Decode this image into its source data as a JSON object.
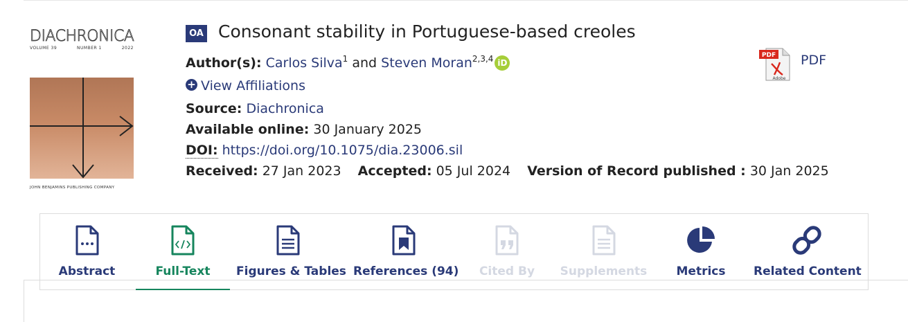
{
  "cover": {
    "journal": "DIACHRONICA",
    "volume": "VOLUME 39",
    "number": "NUMBER 1",
    "year": "2022",
    "publisher": "JOHN BENJAMINS PUBLISHING COMPANY"
  },
  "article": {
    "badge": "OA",
    "title": "Consonant stability in Portuguese-based creoles",
    "authors_label": "Author(s):",
    "author1": "Carlos Silva",
    "author1_sup": "1",
    "and": "and",
    "author2": "Steven Moran",
    "author2_sup": "2,3,4",
    "orcid": "iD",
    "view_affiliations": "View Affiliations",
    "source_label": "Source:",
    "source": "Diachronica",
    "available_label": "Available online:",
    "available": "30 January 2025",
    "doi_label": "DOI:",
    "doi": "https://doi.org/10.1075/dia.23006.sil",
    "received_label": "Received:",
    "received": "27 Jan 2023",
    "accepted_label": "Accepted:",
    "accepted": "05 Jul 2024",
    "vor_label": "Version of Record published :",
    "vor": "30 Jan 2025"
  },
  "pdf": {
    "label": "PDF",
    "icon_text": "PDF",
    "icon_sub": "Adobe"
  },
  "tabs": [
    {
      "label": "Abstract",
      "icon": "document-dots-icon",
      "state": "normal"
    },
    {
      "label": "Full-Text",
      "icon": "document-code-icon",
      "state": "active"
    },
    {
      "label": "Figures & Tables",
      "icon": "document-lines-icon",
      "state": "normal"
    },
    {
      "label": "References (94)",
      "icon": "document-bookmark-icon",
      "state": "normal"
    },
    {
      "label": "Cited By",
      "icon": "document-quote-icon",
      "state": "disabled"
    },
    {
      "label": "Supplements",
      "icon": "document-lines-icon",
      "state": "disabled"
    },
    {
      "label": "Metrics",
      "icon": "pie-chart-icon",
      "state": "normal"
    },
    {
      "label": "Related Content",
      "icon": "link-icon",
      "state": "normal"
    }
  ],
  "colors": {
    "brand": "#2a3a78",
    "active": "#16855d",
    "disabled": "#d4d8e2",
    "orcid": "#a6ce39"
  }
}
